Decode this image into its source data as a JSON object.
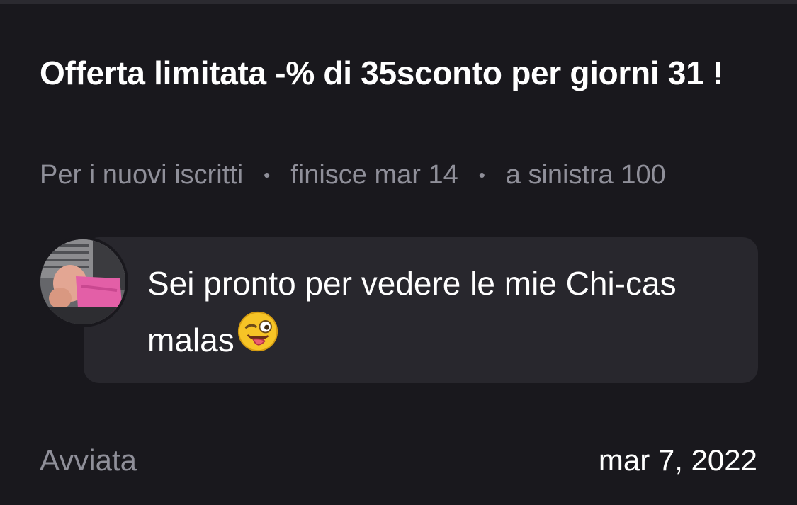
{
  "offer": {
    "title": "Offerta limitata -% di 35sconto per giorni 31 !",
    "audience": "Per i nuovi iscritti",
    "ends": "finisce mar 14",
    "remaining": "a sinistra 100",
    "separator": "•"
  },
  "message": {
    "text": "Sei pronto per vedere le mie Chi-cas malas",
    "emoji_icon": "winking-face-with-tongue-icon"
  },
  "footer": {
    "status": "Avviata",
    "date": "mar 7, 2022"
  },
  "colors": {
    "background": "#19181d",
    "bubble": "#28272d",
    "muted_text": "#8f8f99",
    "primary_text": "#ffffff",
    "avatar_accent": "#e35fa7"
  }
}
